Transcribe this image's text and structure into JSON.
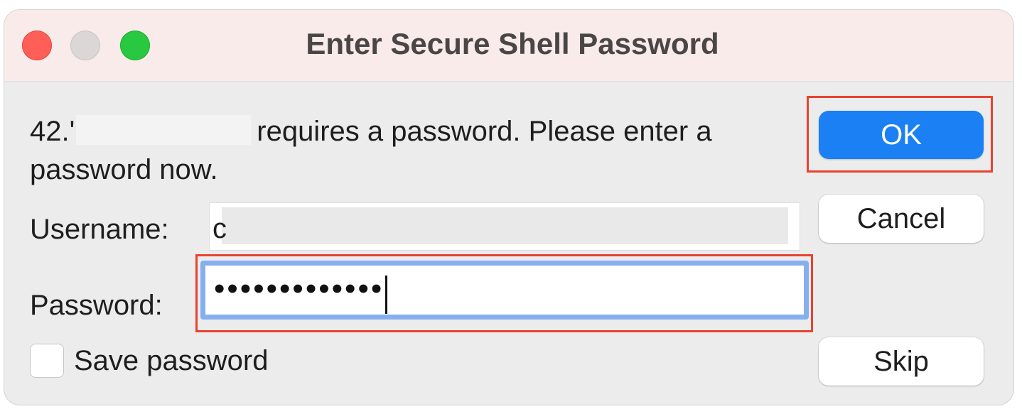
{
  "window": {
    "title": "Enter Secure Shell Password",
    "traffic_lights": [
      "close",
      "minimize",
      "zoom"
    ]
  },
  "message": {
    "host_prefix": "42.'",
    "text_line": "requires a password. Please enter a password now."
  },
  "form": {
    "username_label": "Username:",
    "username_value": "c",
    "password_label": "Password:",
    "password_value": "•••••••••••••",
    "save_password_label": "Save password",
    "save_password_checked": false
  },
  "buttons": {
    "ok_label": "OK",
    "cancel_label": "Cancel",
    "skip_label": "Skip"
  },
  "colors": {
    "ok_button": "#1a80f4",
    "focus_ring": "#86aff0",
    "highlight_box": "#e8432f",
    "titlebar": "#f9ebea"
  }
}
